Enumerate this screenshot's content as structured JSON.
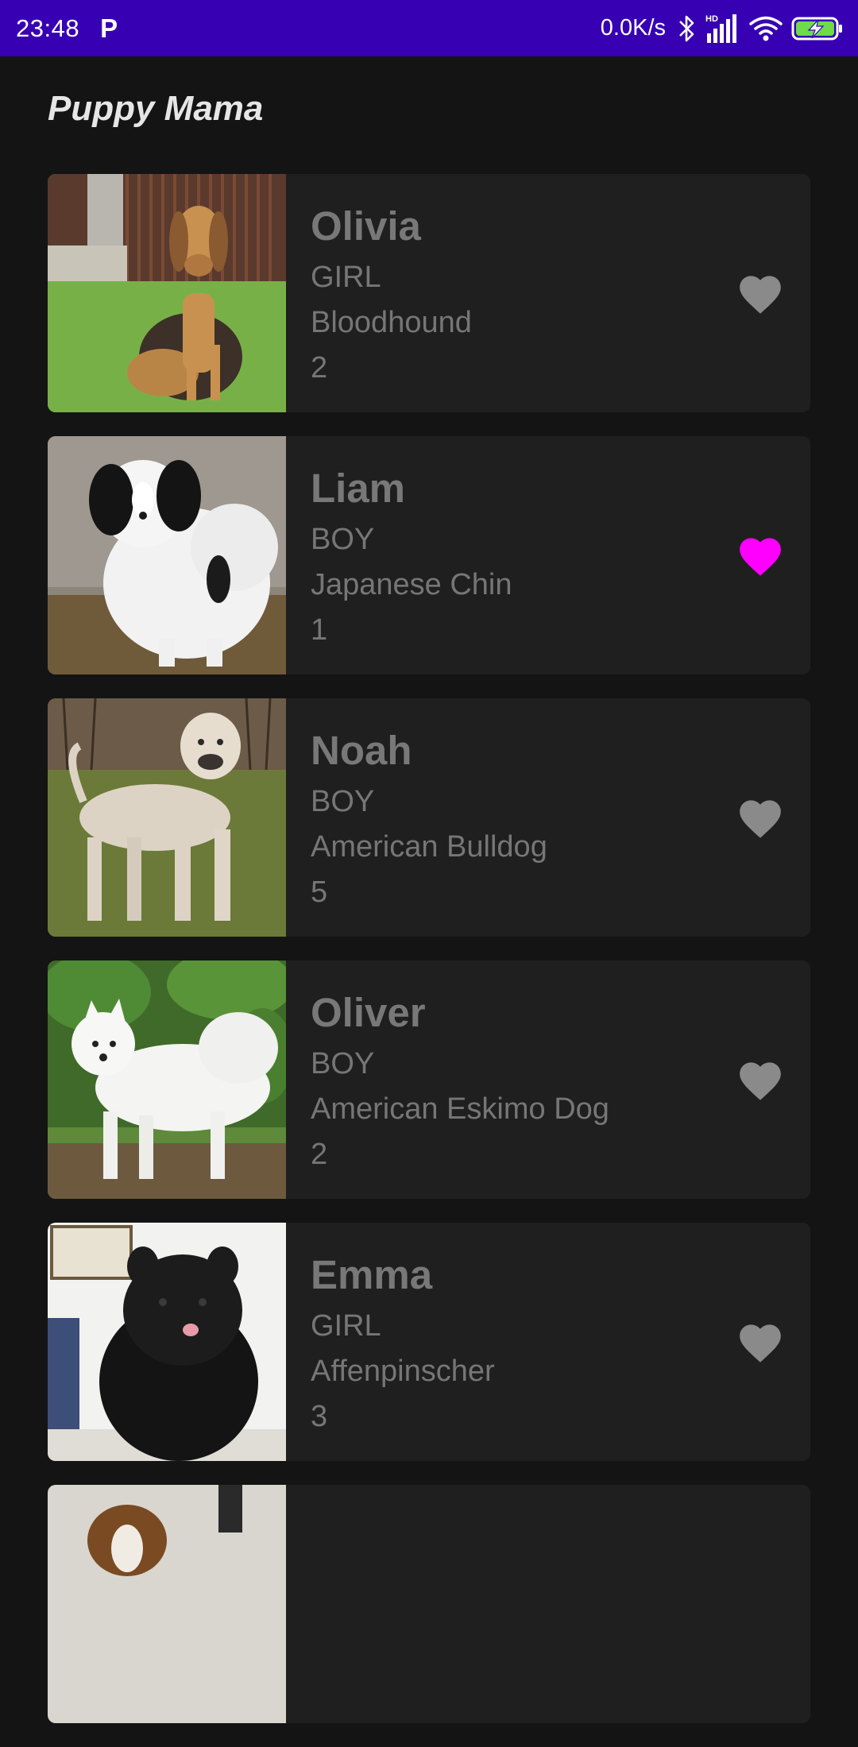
{
  "status_bar": {
    "time": "23:48",
    "app_letter": "P",
    "net_speed": "0.0K/s",
    "hd_label": "HD",
    "colors": {
      "background": "#3700b3",
      "battery_fill": "#6ddb4a"
    }
  },
  "app": {
    "title": "Puppy Mama"
  },
  "colors": {
    "favorite_active": "#ff00ff",
    "favorite_inactive": "#8a8a8a",
    "card_background": "#1f1f1f",
    "page_background": "#141414"
  },
  "puppies": [
    {
      "name": "Olivia",
      "gender": "GIRL",
      "breed": "Bloodhound",
      "age": "2",
      "favorite": false,
      "photo": "bloodhound-photo"
    },
    {
      "name": "Liam",
      "gender": "BOY",
      "breed": "Japanese Chin",
      "age": "1",
      "favorite": true,
      "photo": "japanese-chin-photo"
    },
    {
      "name": "Noah",
      "gender": "BOY",
      "breed": "American Bulldog",
      "age": "5",
      "favorite": false,
      "photo": "american-bulldog-photo"
    },
    {
      "name": "Oliver",
      "gender": "BOY",
      "breed": "American Eskimo Dog",
      "age": "2",
      "favorite": false,
      "photo": "american-eskimo-dog-photo"
    },
    {
      "name": "Emma",
      "gender": "GIRL",
      "breed": "Affenpinscher",
      "age": "3",
      "favorite": false,
      "photo": "affenpinscher-photo"
    },
    {
      "name": "",
      "gender": "",
      "breed": "",
      "age": "",
      "favorite": false,
      "photo": "terrier-photo"
    }
  ]
}
